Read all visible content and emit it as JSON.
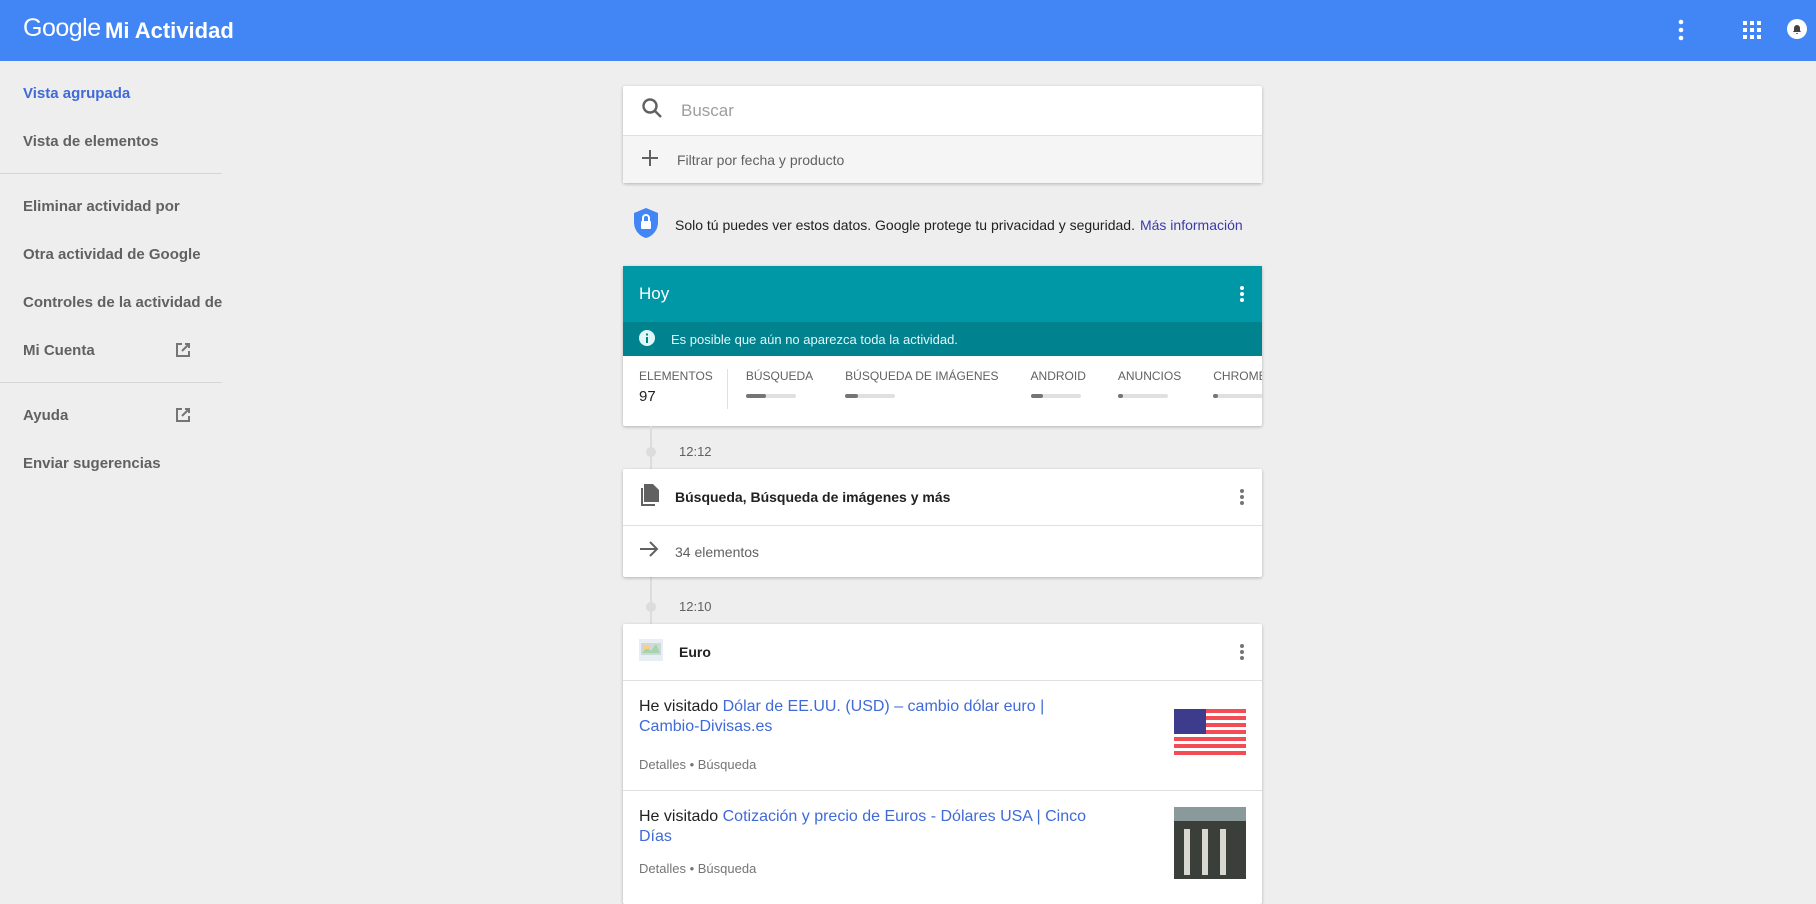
{
  "header": {
    "logo": "Google",
    "title": "Mi Actividad",
    "colors": {
      "bar": "#4285f4"
    },
    "icons": [
      "more-vert-icon",
      "apps-grid-icon",
      "notifications-bell-icon"
    ]
  },
  "sidebar": {
    "items": [
      {
        "label": "Vista agrupada",
        "active": true
      },
      {
        "label": "Vista de elementos"
      },
      {
        "label": "Eliminar actividad por"
      },
      {
        "label": "Otra actividad de Google"
      },
      {
        "label": "Controles de la actividad de tu cuenta"
      },
      {
        "label": "Mi Cuenta",
        "external": true
      },
      {
        "label": "Ayuda",
        "external": true
      },
      {
        "label": "Enviar sugerencias"
      }
    ]
  },
  "search": {
    "placeholder": "Buscar",
    "filter_label": "Filtrar por fecha y producto"
  },
  "privacy": {
    "text": "Solo tú puedes ver estos datos. Google protege tu privacidad y seguridad.",
    "link": "Más información"
  },
  "today": {
    "title": "Hoy",
    "info": "Es posible que aún no aparezca toda la actividad.",
    "total_label": "ELEMENTOS",
    "total": "97",
    "products": [
      {
        "label": "BÚSQUEDA",
        "fraction": 0.4
      },
      {
        "label": "BÚSQUEDA DE IMÁGENES",
        "fraction": 0.25
      },
      {
        "label": "ANDROID",
        "fraction": 0.25
      },
      {
        "label": "ANUNCIOS",
        "fraction": 0.1
      },
      {
        "label": "CHROME",
        "fraction": 0.1
      }
    ]
  },
  "groups": [
    {
      "time": "12:12",
      "title": "Búsqueda, Búsqueda de imágenes y más",
      "count": "34 elementos"
    },
    {
      "time": "12:10",
      "title": "Euro",
      "items": [
        {
          "prefix": "He visitado",
          "link": "Dólar de EE.UU. (USD) – cambio dólar euro | Cambio-Divisas.es",
          "details": "Detalles",
          "product": "Búsqueda"
        },
        {
          "prefix": "He visitado",
          "link": "Cotización y precio de Euros - Dólares USA | Cinco Días",
          "details": "Detalles",
          "product": "Búsqueda"
        }
      ]
    }
  ]
}
